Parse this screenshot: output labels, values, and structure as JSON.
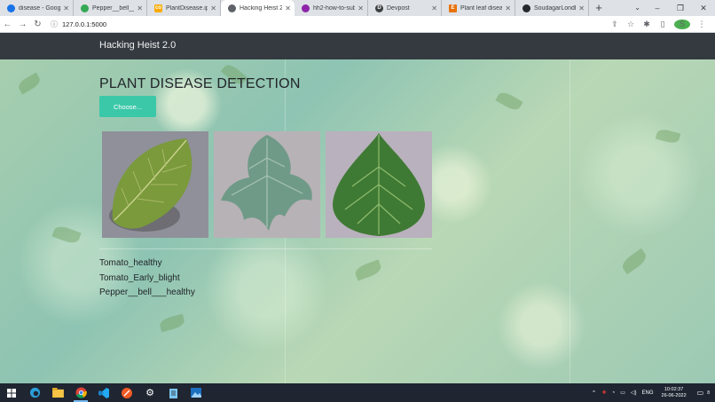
{
  "browser": {
    "tabs": [
      {
        "title": "disease - Googl",
        "fav_color": "#1a73e8",
        "active": false
      },
      {
        "title": "Pepper__bell__B",
        "fav_color": "#34a853",
        "active": false
      },
      {
        "title": "PlantDisease.ipy",
        "fav_color": "#f9ab00",
        "active": false
      },
      {
        "title": "Hacking Heist 2.0",
        "fav_color": "#5f6368",
        "active": true
      },
      {
        "title": "hh2-how-to-sub",
        "fav_color": "#8e24aa",
        "active": false
      },
      {
        "title": "Devpost",
        "fav_color": "#3c4043",
        "active": false
      },
      {
        "title": "Plant leaf disease",
        "fav_color": "#e8710a",
        "active": false
      },
      {
        "title": "SoudagarLondhe",
        "fav_color": "#24292e",
        "active": false
      }
    ],
    "new_tab": "+",
    "url": "127.0.0.1:5000",
    "profile_initial": "S"
  },
  "app": {
    "brand": "Hacking Heist 2.0",
    "title": "PLANT DISEASE DETECTION",
    "choose_label": "Choose..."
  },
  "images": [
    {
      "alt": "textured yellow-green leaf",
      "leaf_color": "#7a9a3c",
      "bg_color": "#8f9099"
    },
    {
      "alt": "pale grey-green lobed leaf",
      "leaf_color": "#6f9a88",
      "bg_color": "#b7b2b6"
    },
    {
      "alt": "smooth dark green leaf",
      "leaf_color": "#3f7a34",
      "bg_color": "#b9b1bd"
    }
  ],
  "results": [
    "Tomato_healthy",
    "Tomato_Early_blight",
    "Pepper__bell___healthy"
  ],
  "taskbar": {
    "language": "ENG",
    "time": "10:02:37",
    "date": "26-06-2022",
    "notifications": "8"
  }
}
